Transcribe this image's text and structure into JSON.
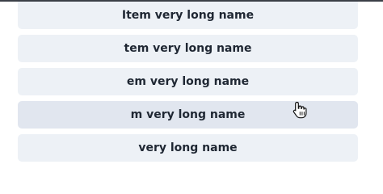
{
  "list": {
    "items": [
      {
        "label": "Item very long name",
        "state": "default"
      },
      {
        "label": "tem very long name",
        "state": "default"
      },
      {
        "label": "em very long name",
        "state": "default"
      },
      {
        "label": "m very long name",
        "state": "hovered"
      },
      {
        "label": "very long name",
        "state": "default"
      }
    ]
  },
  "cursor": {
    "icon": "hand-pointer-icon"
  },
  "colors": {
    "item_bg": "#edf1f6",
    "item_hover_bg": "#e1e6ef",
    "item_text": "#1f2733",
    "top_bar": "#3b3f47"
  }
}
